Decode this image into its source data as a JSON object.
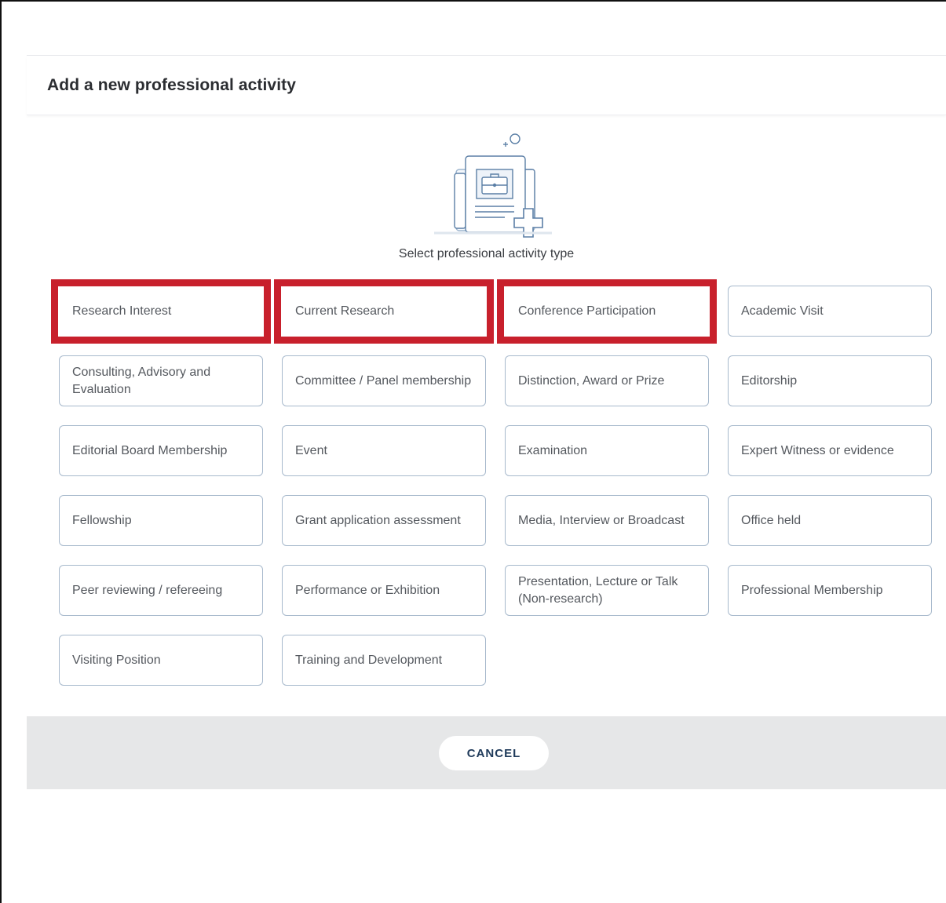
{
  "modal": {
    "title": "Add a new professional activity",
    "subtitle": "Select professional activity type"
  },
  "activity_types": [
    {
      "label": "Research Interest",
      "highlighted": true
    },
    {
      "label": "Current Research",
      "highlighted": true
    },
    {
      "label": "Conference Participation",
      "highlighted": true
    },
    {
      "label": "Academic Visit",
      "highlighted": false
    },
    {
      "label": "Consulting, Advisory and Evaluation",
      "highlighted": false
    },
    {
      "label": "Committee / Panel membership",
      "highlighted": false
    },
    {
      "label": "Distinction, Award or Prize",
      "highlighted": false
    },
    {
      "label": "Editorship",
      "highlighted": false
    },
    {
      "label": "Editorial Board Membership",
      "highlighted": false
    },
    {
      "label": "Event",
      "highlighted": false
    },
    {
      "label": "Examination",
      "highlighted": false
    },
    {
      "label": "Expert Witness or evidence",
      "highlighted": false
    },
    {
      "label": "Fellowship",
      "highlighted": false
    },
    {
      "label": "Grant application assessment",
      "highlighted": false
    },
    {
      "label": "Media, Interview or Broadcast",
      "highlighted": false
    },
    {
      "label": "Office held",
      "highlighted": false
    },
    {
      "label": "Peer reviewing / refereeing",
      "highlighted": false
    },
    {
      "label": "Performance or Exhibition",
      "highlighted": false
    },
    {
      "label": "Presentation, Lecture or Talk (Non-research)",
      "highlighted": false
    },
    {
      "label": "Professional Membership",
      "highlighted": false
    },
    {
      "label": "Visiting Position",
      "highlighted": false
    },
    {
      "label": "Training and Development",
      "highlighted": false
    }
  ],
  "footer": {
    "cancel_label": "CANCEL"
  },
  "colors": {
    "highlight": "#c8202c",
    "tile_border": "#a7b9cc",
    "cancel_text": "#1f3a5a",
    "footer_bg": "#e6e7e8"
  },
  "icons": {
    "illustration": "document-briefcase-plus-icon"
  }
}
